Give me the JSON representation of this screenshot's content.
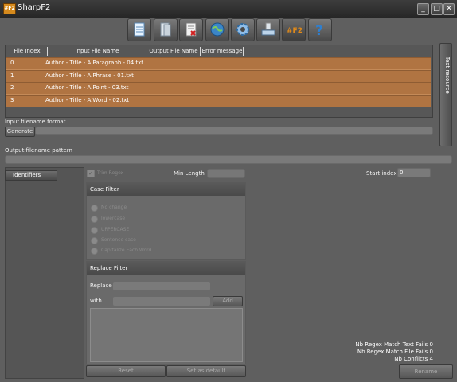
{
  "window": {
    "title": "SharpF2",
    "app_icon_text": "#F2",
    "min": "_",
    "max": "□",
    "close": "✕"
  },
  "toolbar": [
    {
      "name": "document-icon",
      "color": "#e8f4ff"
    },
    {
      "name": "folder-icon",
      "color": "#dfe6ec"
    },
    {
      "name": "delete-document-icon",
      "color": "#f2f2f2"
    },
    {
      "name": "globe-icon",
      "color": "#3b86c8"
    },
    {
      "name": "gear-icon",
      "color": "#8fbde8"
    },
    {
      "name": "keyboard-icon",
      "color": "#bcd4ea"
    },
    {
      "name": "f2-logo-icon",
      "text": "#F2",
      "color": "#e08a1a"
    },
    {
      "name": "help-icon",
      "text": "?",
      "color": "#2f7fcf"
    }
  ],
  "grid": {
    "headers": [
      "File Index",
      "Input File Name",
      "Output File Name",
      "Error message"
    ],
    "rows": [
      {
        "index": "0",
        "input": "Author - Title - A.Paragraph - 04.txt"
      },
      {
        "index": "1",
        "input": "Author - Title - A.Phrase - 01.txt"
      },
      {
        "index": "2",
        "input": "Author - Title - A.Point - 03.txt"
      },
      {
        "index": "3",
        "input": "Author - Title - A.Word - 02.txt"
      }
    ],
    "row_color": "#b07442"
  },
  "side_tab": {
    "label": "Text resource"
  },
  "input_format": {
    "label": "Input filename format",
    "generate": "Generate"
  },
  "output_pattern": {
    "label": "Output filename pattern"
  },
  "identifiers": {
    "tab": "Identifiers"
  },
  "filters": {
    "trim_regex": "Trim Regex",
    "min_length": "Min Length",
    "case_filter": "Case Filter",
    "case_options": [
      "No change",
      "lowercase",
      "UPPERCASE",
      "Sentence case",
      "Capitalize Each Word"
    ],
    "replace_filter": "Replace Filter",
    "replace": "Replace",
    "with": "with",
    "add": "Add",
    "reset": "Reset",
    "set_default": "Set as default"
  },
  "start_index": {
    "label": "Start index",
    "value": "0"
  },
  "stats": {
    "text_fails": "Nb Regex Match Text Fails 0",
    "file_fails": "Nb Regex Match File Fails 0",
    "conflicts": "Nb Conflicts 4"
  },
  "rename": "Rename"
}
